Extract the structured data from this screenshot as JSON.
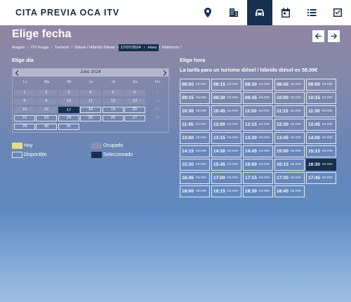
{
  "header": {
    "brand": "CITA PREVIA OCA ITV",
    "nav_icons": [
      "location-pin-icon",
      "building-icon",
      "car-icon",
      "calendar-icon",
      "list-icon",
      "checkbox-icon"
    ],
    "active_nav": "car-icon"
  },
  "page": {
    "title": "Elige fecha",
    "prev_icon": "arrow-left-icon",
    "next_icon": "arrow-right-icon"
  },
  "breadcrumb": [
    "Aragón",
    "ITV Fraga",
    "Turismo",
    "Diésel / Híbrido Diésel",
    "17/07/2024",
    "Hora",
    "Matrícula *"
  ],
  "left": {
    "label": "Elige día",
    "calendar": {
      "month_label": "Julio 2024",
      "weekdays": [
        "Lu",
        "Ma",
        "Mi",
        "Ju",
        "Vi",
        "Sa",
        "Do"
      ],
      "weeks": [
        [
          {
            "d": "1",
            "s": "past"
          },
          {
            "d": "2",
            "s": "past"
          },
          {
            "d": "3",
            "s": "past"
          },
          {
            "d": "4",
            "s": "past"
          },
          {
            "d": "5",
            "s": "past"
          },
          {
            "d": "6",
            "s": "past"
          },
          {
            "d": "7",
            "s": "dim"
          }
        ],
        [
          {
            "d": "8",
            "s": "past"
          },
          {
            "d": "9",
            "s": "past"
          },
          {
            "d": "10",
            "s": "past"
          },
          {
            "d": "11",
            "s": "past"
          },
          {
            "d": "12",
            "s": "past"
          },
          {
            "d": "13",
            "s": "past"
          },
          {
            "d": "14",
            "s": "dim"
          }
        ],
        [
          {
            "d": "15",
            "s": "past"
          },
          {
            "d": "16",
            "s": "past"
          },
          {
            "d": "17",
            "s": "selected"
          },
          {
            "d": "18",
            "s": "avail"
          },
          {
            "d": "19",
            "s": "avail"
          },
          {
            "d": "20",
            "s": "avail"
          },
          {
            "d": "21",
            "s": "dim"
          }
        ],
        [
          {
            "d": "22",
            "s": "avail"
          },
          {
            "d": "23",
            "s": "avail"
          },
          {
            "d": "24",
            "s": "avail"
          },
          {
            "d": "25",
            "s": "avail"
          },
          {
            "d": "26",
            "s": "avail"
          },
          {
            "d": "27",
            "s": "avail"
          },
          {
            "d": "28",
            "s": "dim"
          }
        ],
        [
          {
            "d": "29",
            "s": "avail"
          },
          {
            "d": "30",
            "s": "avail"
          },
          {
            "d": "31",
            "s": "avail"
          }
        ]
      ]
    },
    "legend": {
      "today": "Hoy",
      "occupied": "Ocupado",
      "available": "Disponible",
      "selected": "Seleccionado"
    }
  },
  "right": {
    "label": "Elige hora",
    "subtitle": "La tarifa para un turismo diésel / híbrido diésel es 58.09€",
    "selected_time": "16:30",
    "slots": [
      [
        "08:00",
        "08:15",
        "08:30",
        "08:45",
        "09:00"
      ],
      [
        "09:15",
        "09:30",
        "09:45",
        "10:00",
        "10:15"
      ],
      [
        "10:30",
        "10:45",
        "11:00",
        "11:15",
        "11:30"
      ],
      [
        "11:45",
        "12:00",
        "12:15",
        "12:30",
        "12:45"
      ],
      [
        "13:00",
        "13:15",
        "13:30",
        "13:45",
        "14:00"
      ],
      [
        "14:15",
        "14:30",
        "14:45",
        "15:00",
        "15:15"
      ],
      [
        "15:30",
        "15:45",
        "16:00",
        "16:15",
        "16:30"
      ],
      [
        "16:45",
        "17:00",
        "17:15",
        "17:30",
        "17:45"
      ],
      [
        "18:00",
        "18:15",
        "18:30",
        "18:45"
      ]
    ],
    "price": "58.09€"
  },
  "colors": {
    "navy": "#16304f",
    "today": "#dfe089",
    "occupied": "#8b91b2",
    "selected_price": "#f2d66f"
  }
}
